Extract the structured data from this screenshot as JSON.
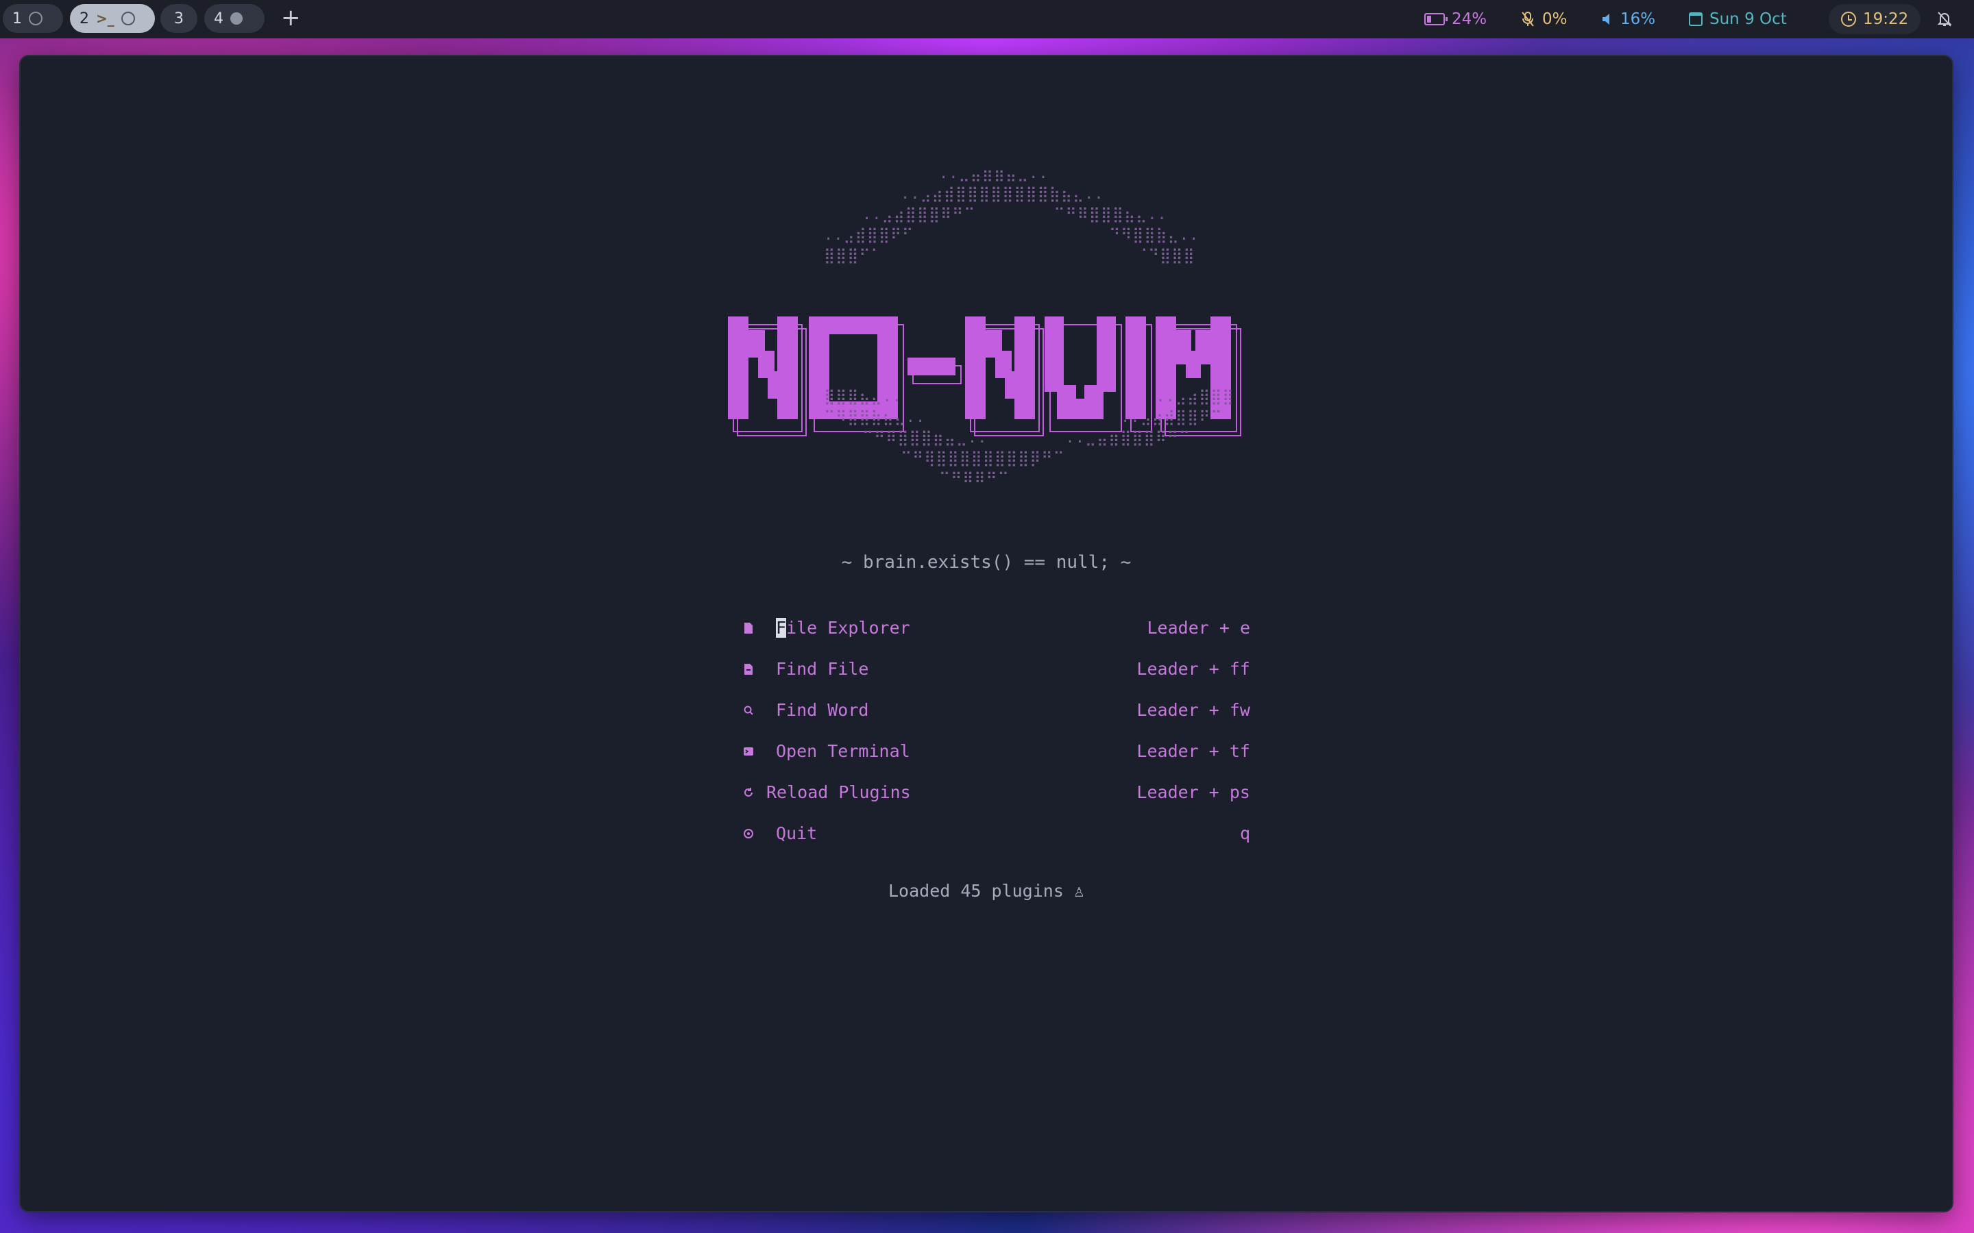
{
  "topbar": {
    "workspaces": [
      {
        "label": "1",
        "active": false
      },
      {
        "label": "2",
        "active": true
      },
      {
        "label": "3",
        "active": false
      },
      {
        "label": "4",
        "active": false
      }
    ],
    "add_icon": "plus-icon",
    "battery": "24%",
    "mic": "0%",
    "volume": "16%",
    "date": "Sun 9 Oct",
    "time": "19:22",
    "colors": {
      "battery": "#c678dd",
      "mic": "#e5c07b",
      "volume": "#61afef",
      "date": "#56b6c2",
      "time": "#e5c07b"
    }
  },
  "dashboard": {
    "logo_text": "NO-NVIM",
    "tagline": "~ brain.exists() == null; ~",
    "menu": [
      {
        "icon": "file-icon",
        "label_first": "F",
        "label_rest": "ile Explorer",
        "key": "Leader + e"
      },
      {
        "icon": "file-text-icon",
        "label": "Find File",
        "key": "Leader + ff"
      },
      {
        "icon": "search-icon",
        "label": "Find Word",
        "key": "Leader + fw"
      },
      {
        "icon": "terminal-icon",
        "label": "Open Terminal",
        "key": "Leader + tf"
      },
      {
        "icon": "refresh-icon",
        "label": "Reload Plugins",
        "key": "Leader + ps"
      },
      {
        "icon": "power-icon",
        "label": "Quit",
        "key": "q"
      }
    ],
    "footer": "Loaded 45 plugins ♙",
    "accent": "#c678dd",
    "background": "#1b1f2b"
  }
}
